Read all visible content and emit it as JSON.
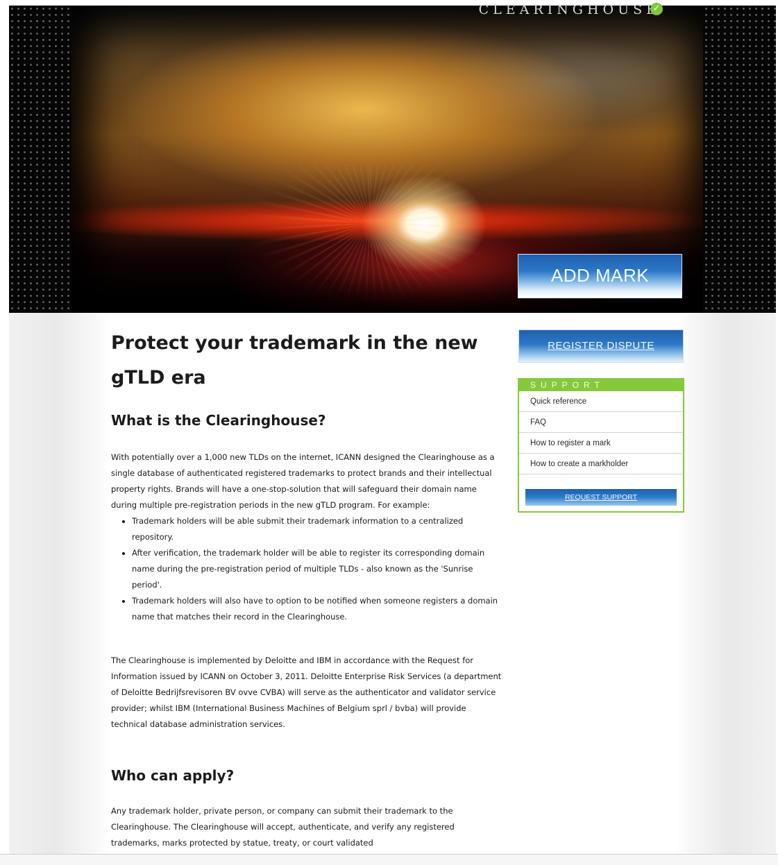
{
  "header": {
    "brand": "CLEARINGHOUSE",
    "brand_check_icon": "check-icon"
  },
  "hero": {
    "add_mark_label": "ADD MARK"
  },
  "main": {
    "title_line1": "Protect your trademark in the new",
    "title_line2": "gTLD era",
    "section1_heading": "What is the Clearinghouse?",
    "section1_para": "With potentially over a 1,000 new TLDs on the internet, ICANN designed the Clearinghouse as a single database of authenticated registered trademarks to protect brands and their intellectual property rights. Brands will have a one-stop-solution that will safeguard their domain name during multiple pre-registration periods in the new gTLD program. For example:",
    "bullets": [
      "Trademark holders will be able submit their trademark information to a centralized repository.",
      "After verification, the trademark holder will be able to register its corresponding domain name during the pre-registration period of multiple TLDs - also known as the 'Sunrise period'.",
      "Trademark holders will also have to option to be notified when someone registers a domain name that matches their record in the Clearinghouse."
    ],
    "section1_para2": "The Clearinghouse is implemented by Deloitte and IBM in accordance with the Request for Information issued by ICANN on October 3, 2011. Deloitte Enterprise Risk Services (a department of Deloitte Bedrijfsrevisoren BV ovve CVBA) will serve as the authenticator and validator service provider; whilst IBM (International Business Machines of Belgium sprl / bvba) will provide technical database administration services.",
    "section2_heading": "Who can apply?",
    "section2_para": "Any trademark holder, private person, or company can submit their trademark to the Clearinghouse. The Clearinghouse will accept, authenticate, and verify any registered trademarks, marks protected by statue, treaty, or court validated"
  },
  "sidebar": {
    "register_dispute_label": "REGISTER DISPUTE",
    "support_title": "SUPPORT",
    "support_items": [
      "Quick reference",
      "FAQ",
      "How to register a mark",
      "How to create a markholder"
    ],
    "request_support_label": "REQUEST SUPPORT"
  },
  "colors": {
    "accent_blue": "#2b77c6",
    "support_green": "#86c93c"
  }
}
